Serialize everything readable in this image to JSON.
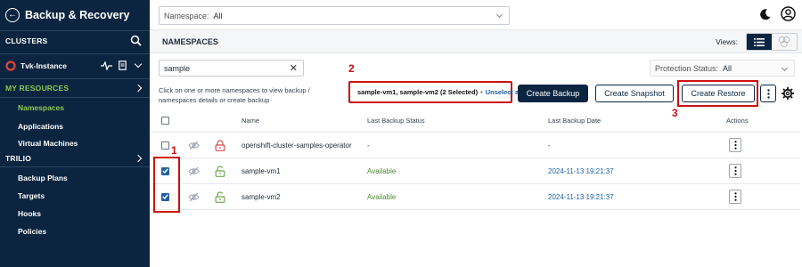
{
  "app": {
    "title": "Backup & Recovery"
  },
  "sidebar": {
    "clusters_label": "CLUSTERS",
    "instance_name": "Tvk-Instance",
    "my_resources_label": "MY RESOURCES",
    "resources": [
      "Namespaces",
      "Applications",
      "Virtual Machines"
    ],
    "trilio_label": "TRILIO",
    "trilio_items": [
      "Backup Plans",
      "Targets",
      "Hooks",
      "Policies"
    ]
  },
  "topbar": {
    "namespace_label": "Namespace:",
    "namespace_value": "All"
  },
  "section": {
    "title": "NAMESPACES",
    "views_label": "Views:"
  },
  "filters": {
    "search_value": "sample",
    "protection_label": "Protection Status:",
    "protection_value": "All"
  },
  "actions": {
    "hint": "Click on one or more namespaces to view backup / namespaces details or create backup",
    "selection": "sample-vm1, sample-vm2 (2 Selected)",
    "separator": "•",
    "unselect_all": "Unselect all",
    "create_backup": "Create Backup",
    "create_snapshot": "Create Snapshot",
    "create_restore": "Create Restore"
  },
  "annotations": {
    "one": "1",
    "two": "2",
    "three": "3"
  },
  "table": {
    "headers": {
      "name": "Name",
      "status": "Last Backup Status",
      "date": "Last Backup Date",
      "actions": "Actions"
    },
    "rows": [
      {
        "name": "openshift-cluster-samples-operator",
        "status": "-",
        "date": "-",
        "checked": false,
        "locked": true
      },
      {
        "name": "sample-vm1",
        "status": "Available",
        "date": "2024-11-13 19:21:37",
        "checked": true,
        "locked": false
      },
      {
        "name": "sample-vm2",
        "status": "Available",
        "date": "2024-11-13 19:21:37",
        "checked": true,
        "locked": false
      }
    ]
  },
  "colors": {
    "nav": "#0b2540",
    "accent_green": "#8fc651",
    "link_blue": "#1f61a8",
    "annotation_red": "#cc1111"
  },
  "icons": [
    "back-arrow-icon",
    "moon-icon",
    "user-icon",
    "search-icon",
    "cluster-icon",
    "heartbeat-icon",
    "document-icon",
    "chevron-down-icon",
    "chevron-right-icon",
    "list-view-icon",
    "grid-view-icon",
    "close-icon",
    "kebab-icon",
    "gear-icon",
    "eye-off-icon",
    "lock-icon",
    "unlock-icon"
  ]
}
